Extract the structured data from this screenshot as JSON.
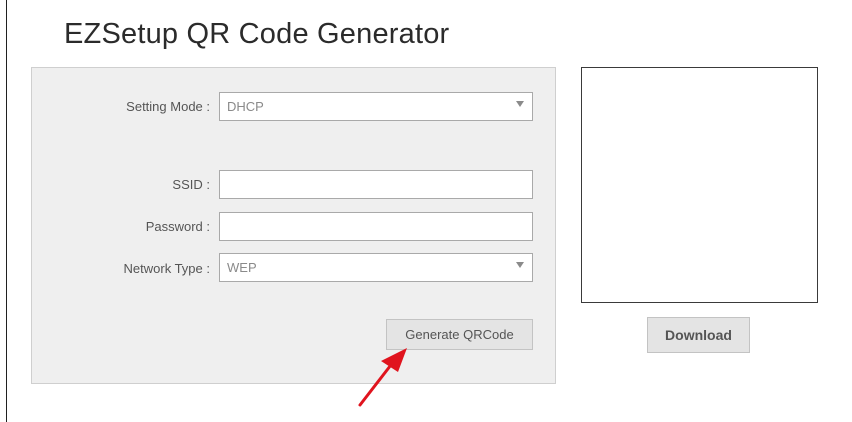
{
  "page": {
    "title": "EZSetup QR Code Generator"
  },
  "form": {
    "setting_mode": {
      "label": "Setting Mode :",
      "value": "DHCP"
    },
    "ssid": {
      "label": "SSID :",
      "value": ""
    },
    "password": {
      "label": "Password :",
      "value": ""
    },
    "network_type": {
      "label": "Network Type :",
      "value": "WEP"
    },
    "generate_label": "Generate QRCode"
  },
  "qr_panel": {
    "download_label": "Download"
  },
  "colors": {
    "arrow": "#e0141e",
    "panel_bg": "#efefef",
    "button_bg": "#e4e4e4"
  }
}
